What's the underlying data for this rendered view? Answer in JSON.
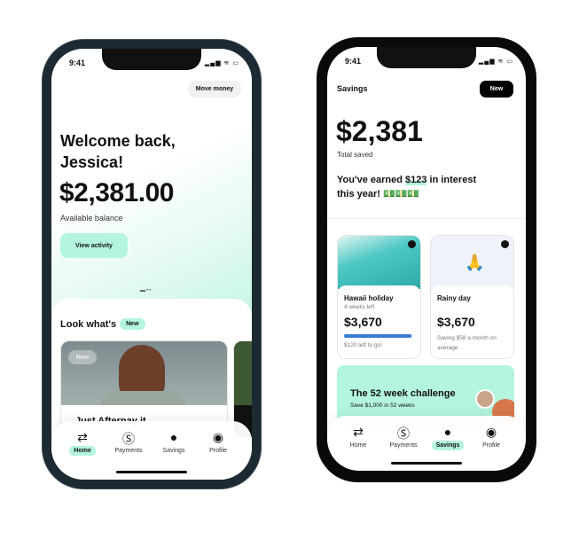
{
  "status_bar": {
    "time": "9:41",
    "icons": "signal wifi battery"
  },
  "phone1": {
    "move_money": "Move money",
    "greeting": "Welcome back, Jessica!",
    "balance": "$2,381.00",
    "balance_label": "Available balance",
    "view_activity": "View activity",
    "section_title": "Look what's",
    "section_badge": "New",
    "card_badge": "New",
    "card_title": "Just Afterpay it",
    "nav": [
      {
        "label": "Home",
        "icon": "home-arrows-icon",
        "active": true
      },
      {
        "label": "Payments",
        "icon": "dollar-cycle-icon"
      },
      {
        "label": "Savings",
        "icon": "piggy-bank-icon"
      },
      {
        "label": "Profile",
        "icon": "profile-icon"
      }
    ]
  },
  "phone2": {
    "title": "Savings",
    "new_button": "New",
    "total": "$2,381",
    "total_label": "Total saved",
    "interest_pre": "You've earned ",
    "interest_amount": "$123",
    "interest_post": " in interest this year! 💵💵💵",
    "goals": [
      {
        "title": "Hawaii holiday",
        "subtitle": "4 weeks left",
        "amount": "$3,670",
        "progress": 0.96,
        "note": "$120 left to go!"
      },
      {
        "title": "Rainy day",
        "emoji": "🙏",
        "amount": "$3,670",
        "note": "Saving $58 a month on average"
      }
    ],
    "challenge_title": "The 52 week challenge",
    "challenge_sub": "Save $1,000 in 52 weeks",
    "nav": [
      {
        "label": "Home"
      },
      {
        "label": "Payments"
      },
      {
        "label": "Savings",
        "active": true
      },
      {
        "label": "Profile"
      }
    ]
  },
  "colors": {
    "mint": "#b3f5dd",
    "progress": "#3b7bd6",
    "frame1": "#1c2a33"
  }
}
